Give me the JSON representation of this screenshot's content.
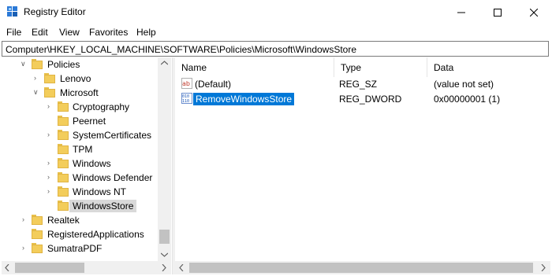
{
  "window": {
    "title": "Registry Editor",
    "controls": [
      "minimize",
      "maximize",
      "close"
    ]
  },
  "menu": [
    "File",
    "Edit",
    "View",
    "Favorites",
    "Help"
  ],
  "address": "Computer\\HKEY_LOCAL_MACHINE\\SOFTWARE\\Policies\\Microsoft\\WindowsStore",
  "tree": [
    {
      "label": "Policies",
      "level": 1,
      "expanded": true
    },
    {
      "label": "Lenovo",
      "level": 2,
      "expanded": false
    },
    {
      "label": "Microsoft",
      "level": 2,
      "expanded": true
    },
    {
      "label": "Cryptography",
      "level": 3,
      "expanded": false
    },
    {
      "label": "Peernet",
      "level": 3,
      "expanded": null
    },
    {
      "label": "SystemCertificates",
      "level": 3,
      "expanded": false
    },
    {
      "label": "TPM",
      "level": 3,
      "expanded": null
    },
    {
      "label": "Windows",
      "level": 3,
      "expanded": false
    },
    {
      "label": "Windows Defender",
      "level": 3,
      "expanded": false
    },
    {
      "label": "Windows NT",
      "level": 3,
      "expanded": false
    },
    {
      "label": "WindowsStore",
      "level": 3,
      "expanded": null,
      "selected": true
    },
    {
      "label": "Realtek",
      "level": 1,
      "expanded": false
    },
    {
      "label": "RegisteredApplications",
      "level": 1,
      "expanded": null
    },
    {
      "label": "SumatraPDF",
      "level": 1,
      "expanded": false
    }
  ],
  "list": {
    "columns": [
      "Name",
      "Type",
      "Data"
    ],
    "rows": [
      {
        "icon": "string-value-icon",
        "name": "(Default)",
        "type": "REG_SZ",
        "data": "(value not set)"
      },
      {
        "icon": "binary-value-icon",
        "name": "RemoveWindowsStore",
        "type": "REG_DWORD",
        "data": "0x00000001 (1)",
        "selected": true
      }
    ]
  },
  "colors": {
    "selection": "#0078d7",
    "folder": "#f3cd5b",
    "tree_selection": "#d9d9d9"
  }
}
